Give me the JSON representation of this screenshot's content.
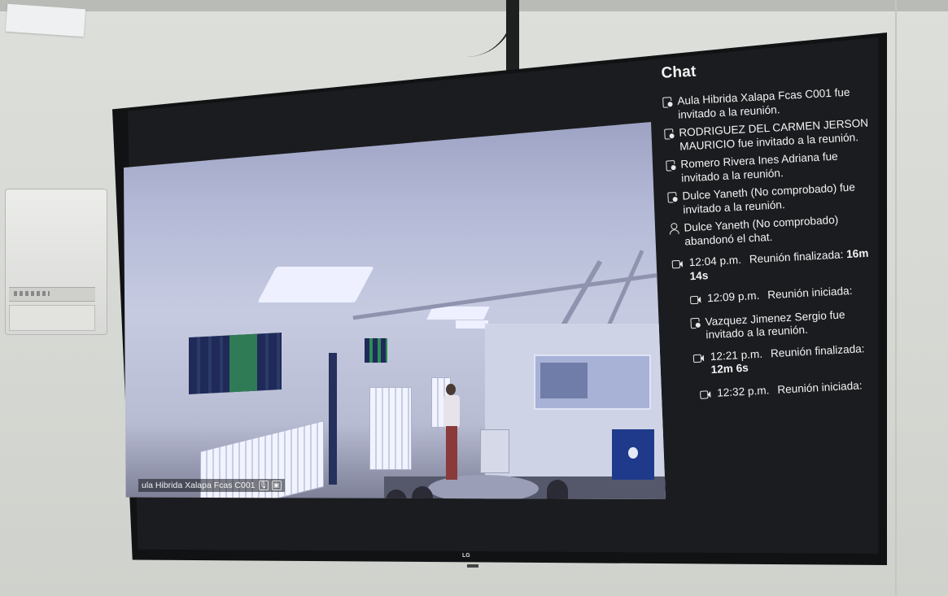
{
  "chat": {
    "title": "Chat",
    "messages": [
      {
        "type": "invite",
        "text": "Aula Hibrida Xalapa Fcas C001 fue invitado a la reunión."
      },
      {
        "type": "invite",
        "text": "RODRIGUEZ DEL CARMEN JERSON MAURICIO fue invitado a la reunión."
      },
      {
        "type": "invite",
        "text": "Romero Rivera Ines Adriana fue invitado a la reunión."
      },
      {
        "type": "invite",
        "text": "Dulce Yaneth (No comprobado) fue invitado a la reunión."
      },
      {
        "type": "leave",
        "text": "Dulce Yaneth (No comprobado) abandonó el chat."
      },
      {
        "type": "meeting",
        "time": "12:04 p.m.",
        "label": "Reunión finalizada:",
        "duration": "16m 14s"
      },
      {
        "type": "meeting",
        "time": "12:09 p.m.",
        "label": "Reunión iniciada:"
      },
      {
        "type": "invite",
        "text": "Vazquez Jimenez Sergio fue invitado a la reunión."
      },
      {
        "type": "meeting",
        "time": "12:21 p.m.",
        "label": "Reunión finalizada:",
        "duration": "12m 6s"
      },
      {
        "type": "meeting",
        "time": "12:32 p.m.",
        "label": "Reunión iniciada:"
      }
    ]
  },
  "video": {
    "caption": "ula Hibrida Xalapa Fcas C001"
  },
  "tv": {
    "brand": "LG"
  },
  "icons": {
    "invite": "calendar-add-icon",
    "leave": "person-leave-icon",
    "meeting": "video-camera-icon",
    "mic": "microphone-icon",
    "screen": "screen-share-icon"
  }
}
